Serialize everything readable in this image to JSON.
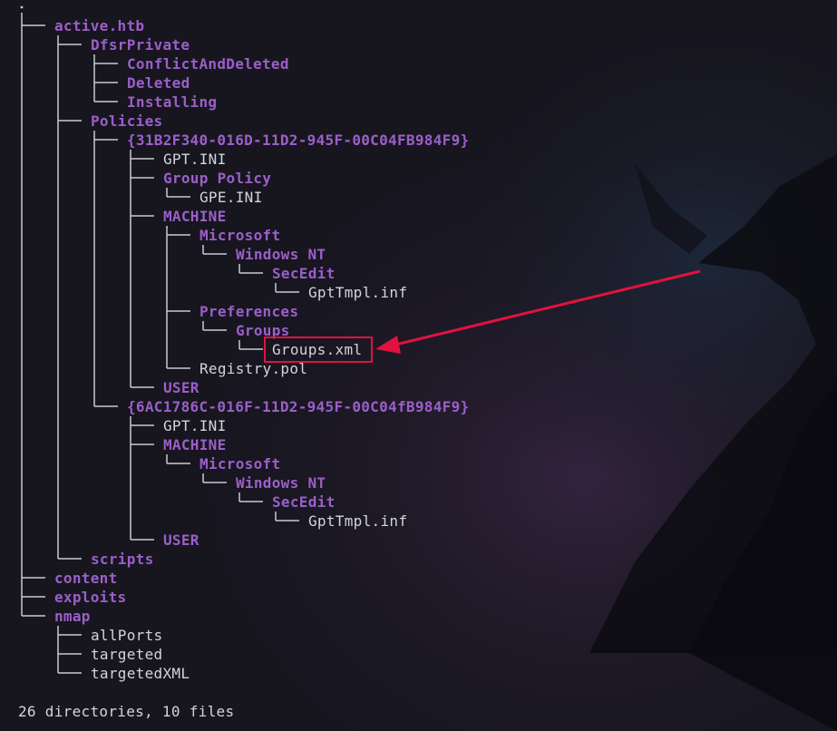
{
  "theme": {
    "background": "#17161f",
    "directory_color": "#9b5fc9",
    "file_color": "#d4d4dc",
    "highlight_color": "#e0123f"
  },
  "tree": {
    "root_dot": ".",
    "items": [
      {
        "name": "active.htb",
        "type": "dir"
      },
      {
        "name": "DfsrPrivate",
        "type": "dir"
      },
      {
        "name": "ConflictAndDeleted",
        "type": "dir"
      },
      {
        "name": "Deleted",
        "type": "dir"
      },
      {
        "name": "Installing",
        "type": "dir"
      },
      {
        "name": "Policies",
        "type": "dir"
      },
      {
        "name": "{31B2F340-016D-11D2-945F-00C04FB984F9}",
        "type": "dir"
      },
      {
        "name": "GPT.INI",
        "type": "file"
      },
      {
        "name": "Group Policy",
        "type": "dir"
      },
      {
        "name": "GPE.INI",
        "type": "file"
      },
      {
        "name": "MACHINE",
        "type": "dir"
      },
      {
        "name": "Microsoft",
        "type": "dir"
      },
      {
        "name": "Windows NT",
        "type": "dir"
      },
      {
        "name": "SecEdit",
        "type": "dir"
      },
      {
        "name": "GptTmpl.inf",
        "type": "file"
      },
      {
        "name": "Preferences",
        "type": "dir"
      },
      {
        "name": "Groups",
        "type": "dir"
      },
      {
        "name": "Groups.xml",
        "type": "file",
        "highlighted": true
      },
      {
        "name": "Registry.pol",
        "type": "file"
      },
      {
        "name": "USER",
        "type": "dir"
      },
      {
        "name": "{6AC1786C-016F-11D2-945F-00C04fB984F9}",
        "type": "dir"
      },
      {
        "name": "GPT.INI",
        "type": "file"
      },
      {
        "name": "MACHINE",
        "type": "dir"
      },
      {
        "name": "Microsoft",
        "type": "dir"
      },
      {
        "name": "Windows NT",
        "type": "dir"
      },
      {
        "name": "SecEdit",
        "type": "dir"
      },
      {
        "name": "GptTmpl.inf",
        "type": "file"
      },
      {
        "name": "USER",
        "type": "dir"
      },
      {
        "name": "scripts",
        "type": "dir"
      },
      {
        "name": "content",
        "type": "dir"
      },
      {
        "name": "exploits",
        "type": "dir"
      },
      {
        "name": "nmap",
        "type": "dir"
      },
      {
        "name": "allPorts",
        "type": "file"
      },
      {
        "name": "targeted",
        "type": "file"
      },
      {
        "name": "targetedXML",
        "type": "file"
      }
    ]
  },
  "summary": "26 directories, 10 files",
  "annotation": {
    "highlight_target": "Groups.xml",
    "arrow": "pointing-left"
  }
}
